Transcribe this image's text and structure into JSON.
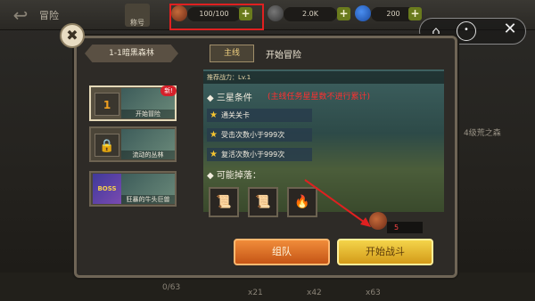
{
  "topbar": {
    "back_icon": "back-arrow-icon",
    "title": "冒险",
    "badge_label": "称号",
    "stamina": "100/100",
    "gold": "2.0K",
    "gems": "200"
  },
  "system": {
    "home_icon": "home-icon",
    "more_icon": "more-icon",
    "close_icon": "close-icon"
  },
  "panel": {
    "stage_title": "1-1暗黑森林",
    "tab_main": "主线",
    "tab_title": "开始冒险",
    "recommended_power": "推荐战力：Lv.1",
    "three_star_title": "◆ 三星条件",
    "red_note": "(主线任务星星数不进行累计)",
    "conditions": [
      "通关关卡",
      "受击次数小于999次",
      "复活次数小于999次"
    ],
    "drops_title": "◆ 可能掉落：",
    "cost_value": "5",
    "team_button": "组队",
    "fight_button": "开始战斗",
    "new_badge": "新!"
  },
  "stage_list": [
    {
      "number": "1",
      "label": "开始冒险"
    },
    {
      "label": "流动的丛林"
    },
    {
      "boss_text": "BOSS",
      "label": "狂暴的牛头巨兽"
    }
  ],
  "bottom": {
    "progress": "0/63",
    "count1": "x21",
    "count2": "x42",
    "count3": "x63",
    "right_label": "4级荒之森"
  }
}
